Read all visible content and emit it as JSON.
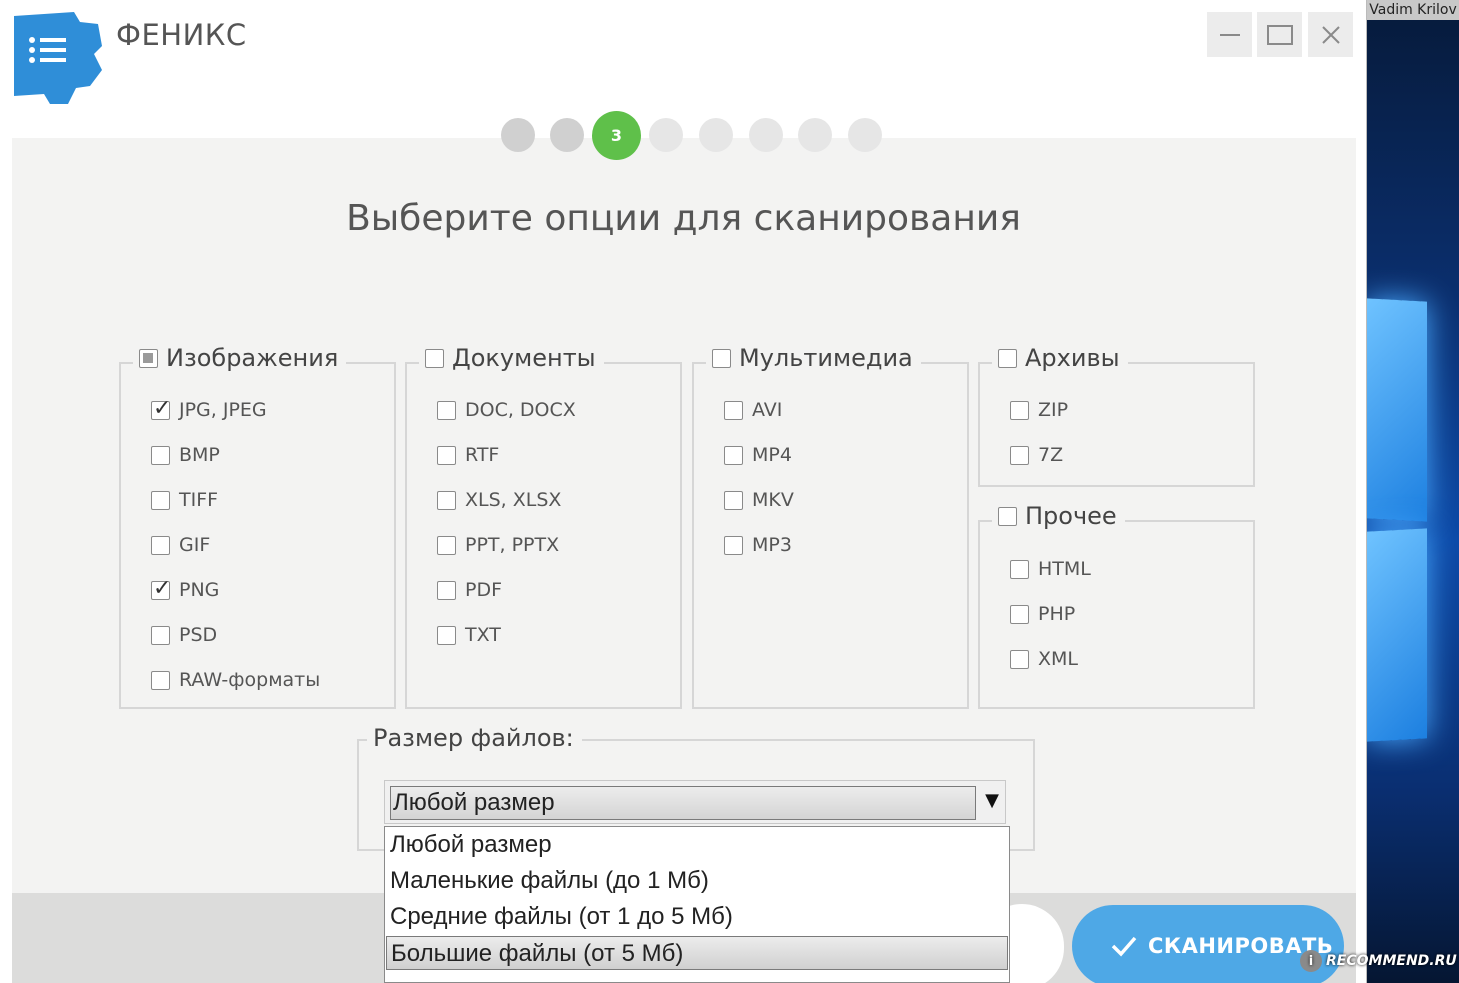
{
  "app": {
    "title": "ФЕНИКС"
  },
  "desktop": {
    "user_name": "Vadim Krilov"
  },
  "wizard": {
    "current_step": "3",
    "total_steps": 8,
    "heading": "Выберите опции для сканирования"
  },
  "groups": {
    "images": {
      "label": "Изображения",
      "state": "partial",
      "items": [
        {
          "label": "JPG, JPEG",
          "checked": true
        },
        {
          "label": "BMP",
          "checked": false
        },
        {
          "label": "TIFF",
          "checked": false
        },
        {
          "label": "GIF",
          "checked": false
        },
        {
          "label": "PNG",
          "checked": true
        },
        {
          "label": "PSD",
          "checked": false
        },
        {
          "label": "RAW-форматы",
          "checked": false
        }
      ]
    },
    "documents": {
      "label": "Документы",
      "state": "unchecked",
      "items": [
        {
          "label": "DOC, DOCX",
          "checked": false
        },
        {
          "label": "RTF",
          "checked": false
        },
        {
          "label": "XLS, XLSX",
          "checked": false
        },
        {
          "label": "PPT, PPTX",
          "checked": false
        },
        {
          "label": "PDF",
          "checked": false
        },
        {
          "label": "TXT",
          "checked": false
        }
      ]
    },
    "multimedia": {
      "label": "Мультимедиа",
      "state": "unchecked",
      "items": [
        {
          "label": "AVI",
          "checked": false
        },
        {
          "label": "MP4",
          "checked": false
        },
        {
          "label": "MKV",
          "checked": false
        },
        {
          "label": "MP3",
          "checked": false
        }
      ]
    },
    "archives": {
      "label": "Архивы",
      "state": "unchecked",
      "items": [
        {
          "label": "ZIP",
          "checked": false
        },
        {
          "label": "7Z",
          "checked": false
        }
      ]
    },
    "other": {
      "label": "Прочее",
      "state": "unchecked",
      "items": [
        {
          "label": "HTML",
          "checked": false
        },
        {
          "label": "PHP",
          "checked": false
        },
        {
          "label": "XML",
          "checked": false
        }
      ]
    }
  },
  "file_size": {
    "label": "Размер файлов:",
    "selected": "Любой размер",
    "options": [
      "Любой размер",
      "Маленькие файлы (до 1 Мб)",
      "Средние файлы (от 1 до 5 Мб)",
      "Большие файлы (от 5 Мб)"
    ],
    "highlighted_option": 3
  },
  "buttons": {
    "scan": "СКАНИРОВАТЬ"
  },
  "watermark": {
    "badge": "i",
    "text": "RECOMMEND.RU"
  },
  "colors": {
    "accent_green": "#5fc04a",
    "accent_blue": "#4ea8e6",
    "logo_blue": "#2f8ed8"
  },
  "icons": {
    "logo": "gear-menu-icon",
    "scan": "check-icon",
    "minimize": "minimize-icon",
    "maximize": "maximize-icon",
    "close": "close-icon",
    "dropdown": "triangle-down-icon"
  }
}
